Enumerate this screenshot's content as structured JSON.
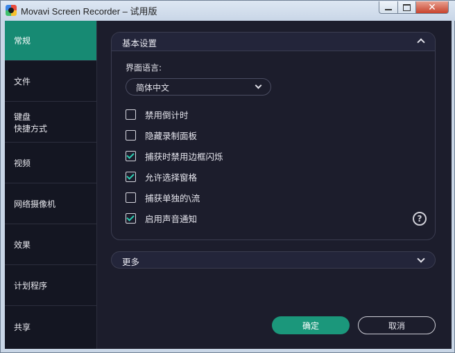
{
  "window": {
    "title": "Movavi Screen Recorder – 试用版",
    "close_glyph": "✕"
  },
  "sidebar": {
    "items": [
      {
        "label": "常规",
        "active": true
      },
      {
        "label": "文件"
      },
      {
        "label": "键盘",
        "label2": "快捷方式"
      },
      {
        "label": "视频"
      },
      {
        "label": "网络摄像机"
      },
      {
        "label": "效果"
      },
      {
        "label": "计划程序"
      },
      {
        "label": "共享"
      }
    ]
  },
  "basic": {
    "title": "基本设置",
    "language_label": "界面语言:",
    "language_value": "简体中文",
    "options": [
      {
        "label": "禁用倒计时",
        "checked": false
      },
      {
        "label": "隐藏录制面板",
        "checked": false
      },
      {
        "label": "捕获时禁用边框闪烁",
        "checked": true
      },
      {
        "label": "允许选择窗格",
        "checked": true
      },
      {
        "label": "捕获单独的\\流",
        "checked": false
      },
      {
        "label": "启用声音通知",
        "checked": true
      }
    ],
    "help_glyph": "?"
  },
  "more": {
    "label": "更多"
  },
  "buttons": {
    "ok": "确定",
    "cancel": "取消"
  },
  "colors": {
    "accent": "#178a73",
    "background": "#1c1d2c",
    "check": "#2bd0b3"
  }
}
